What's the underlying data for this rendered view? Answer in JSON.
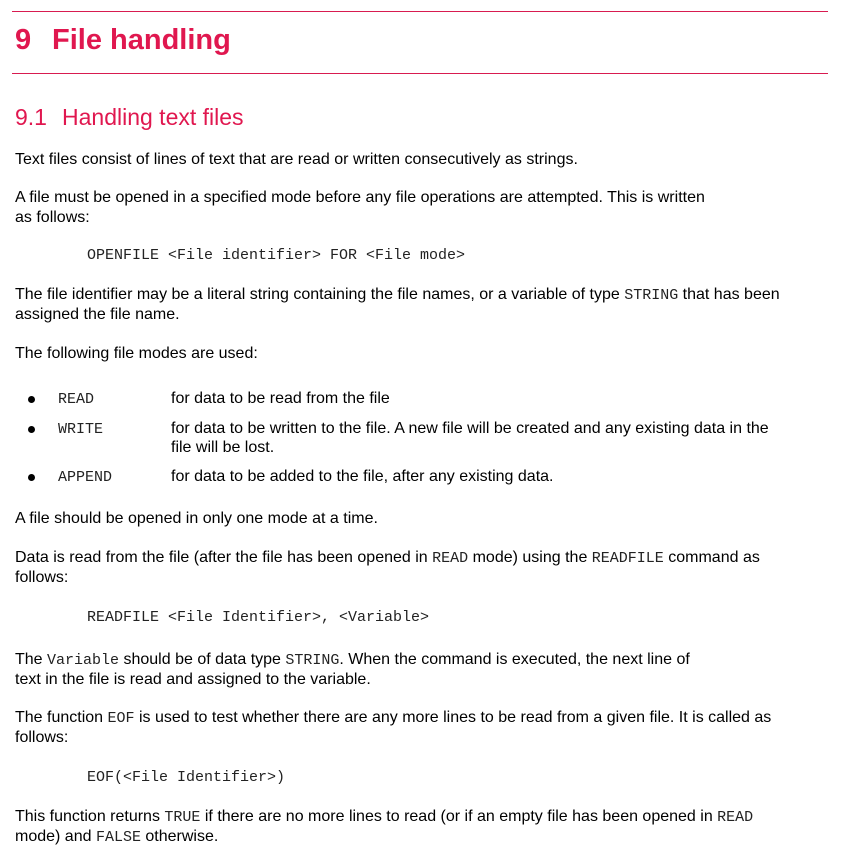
{
  "heading": {
    "number": "9",
    "title": "File handling"
  },
  "subheading": {
    "number": "9.1",
    "title": "Handling text files"
  },
  "colors": {
    "accent": "#e0174f"
  },
  "blocks": [
    {
      "lines": [
        [
          {
            "t": "Text files consist of lines of text that are read or written consecutively as strings."
          }
        ]
      ]
    },
    {
      "lines": [
        [
          {
            "t": "A file must be opened in a specified mode before any file operations are attempted. This is written"
          }
        ],
        [
          {
            "t": "as follows:"
          }
        ]
      ]
    },
    {
      "code": true,
      "lines": [
        [
          {
            "t": "OPENFILE <File identifier> FOR <File mode>",
            "c": 1
          }
        ]
      ]
    },
    {
      "lines": [
        [
          {
            "t": "The file identifier may be a literal string containing the file names, or a variable of type "
          },
          {
            "t": "STRING",
            "c": 1
          },
          {
            "t": " that has been"
          }
        ],
        [
          {
            "t": "assigned the file name."
          }
        ]
      ]
    },
    {
      "lines": [
        [
          {
            "t": "The following file modes are used:"
          }
        ]
      ]
    },
    {
      "lines": [
        [
          {
            "t": "A file should be opened in only one mode at a time."
          }
        ]
      ]
    },
    {
      "lines": [
        [
          {
            "t": "Data is read from the file (after the file has been opened in "
          },
          {
            "t": "READ",
            "c": 1
          },
          {
            "t": " mode) using the "
          },
          {
            "t": "READFILE",
            "c": 1
          },
          {
            "t": " command as"
          }
        ],
        [
          {
            "t": "follows:"
          }
        ]
      ]
    },
    {
      "code": true,
      "lines": [
        [
          {
            "t": "READFILE <File Identifier>, <Variable>",
            "c": 1
          }
        ]
      ]
    },
    {
      "lines": [
        [
          {
            "t": "The "
          },
          {
            "t": "Variable",
            "c": 1
          },
          {
            "t": " should be of data type "
          },
          {
            "t": "STRING",
            "c": 1
          },
          {
            "t": ". When the command is executed, the next line of"
          }
        ],
        [
          {
            "t": "text in the file is read and assigned to the variable."
          }
        ]
      ]
    },
    {
      "lines": [
        [
          {
            "t": "The function "
          },
          {
            "t": "EOF",
            "c": 1
          },
          {
            "t": " is used to test whether there are any more lines to be read from a given file. It is called as"
          }
        ],
        [
          {
            "t": "follows:"
          }
        ]
      ]
    },
    {
      "code": true,
      "lines": [
        [
          {
            "t": "EOF(<File Identifier>)",
            "c": 1
          }
        ]
      ]
    },
    {
      "lines": [
        [
          {
            "t": "This function returns "
          },
          {
            "t": "TRUE",
            "c": 1
          },
          {
            "t": " if there are no more lines to read (or if an empty file has been opened in "
          },
          {
            "t": "READ",
            "c": 1
          }
        ],
        [
          {
            "t": "mode) and "
          },
          {
            "t": "FALSE",
            "c": 1
          },
          {
            "t": " otherwise."
          }
        ]
      ]
    }
  ],
  "modes": [
    {
      "mode": "READ",
      "description": [
        "for data to be read from the file"
      ]
    },
    {
      "mode": "WRITE",
      "description": [
        "for data to be written to the file. A new file will be created and any existing data in the",
        "file will be lost."
      ]
    },
    {
      "mode": "APPEND",
      "description": [
        "for data to be added to the file, after any existing data."
      ]
    }
  ]
}
